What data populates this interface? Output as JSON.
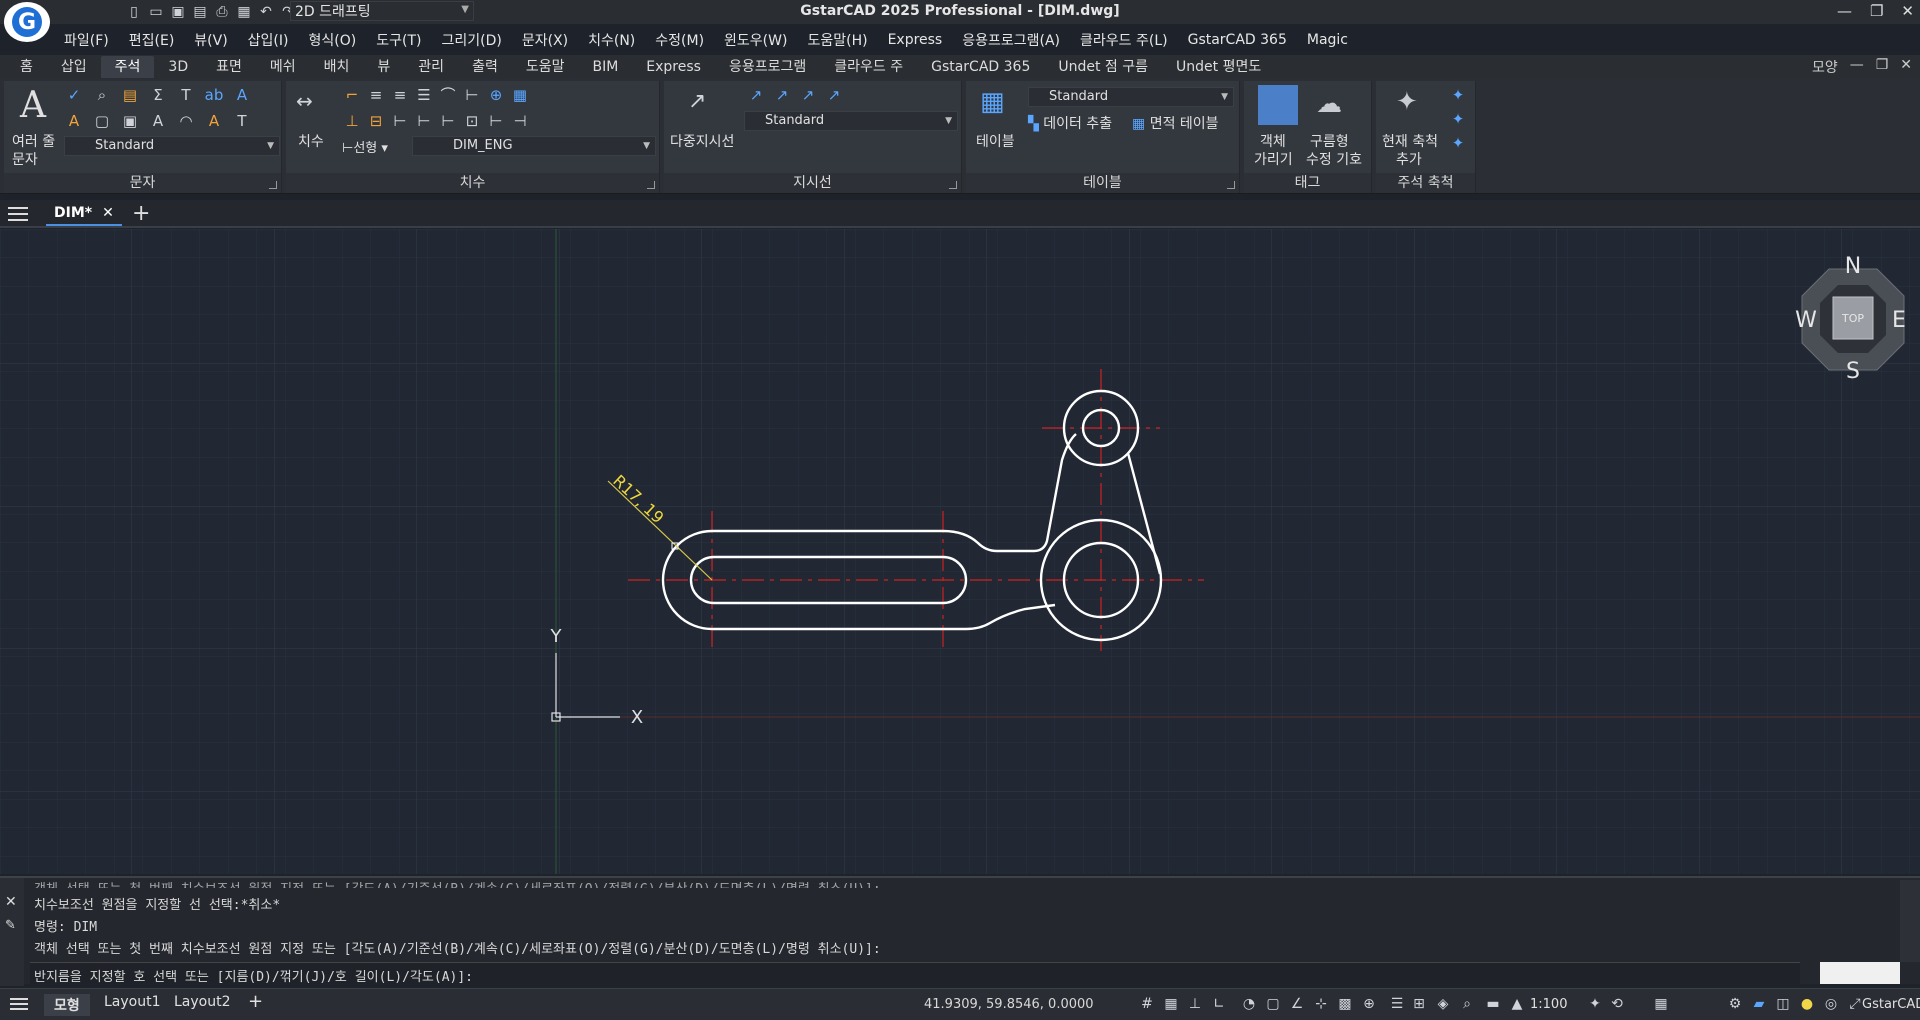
{
  "app": {
    "title": "GstarCAD 2025 Professional - [DIM.dwg]",
    "workspace": "2D 드래프팅",
    "logo_letter": "G"
  },
  "menu": [
    "파일(F)",
    "편집(E)",
    "뷰(V)",
    "삽입(I)",
    "형식(O)",
    "도구(T)",
    "그리기(D)",
    "문자(X)",
    "치수(N)",
    "수정(M)",
    "윈도우(W)",
    "도움말(H)",
    "Express",
    "응용프로그램(A)",
    "클라우드 주(L)",
    "GstarCAD 365",
    "Magic"
  ],
  "ribbon_tabs": [
    "홈",
    "삽입",
    "주석",
    "3D",
    "표면",
    "메쉬",
    "배치",
    "뷰",
    "관리",
    "출력",
    "도움말",
    "BIM",
    "Express",
    "응용프로그램",
    "클라우드 주",
    "GstarCAD 365",
    "Undet 점 구름",
    "Undet 평면도"
  ],
  "ribbon_tab_active": "주석",
  "ribbon_right": "모양",
  "panels": {
    "text": {
      "title": "문자",
      "big_label_1": "여러 줄",
      "big_label_2": "문자",
      "style": "Standard"
    },
    "dim": {
      "title": "치수",
      "big_label": "치수",
      "linear": "선형",
      "style": "DIM_ENG"
    },
    "leader": {
      "title": "지시선",
      "big_label": "다중지시선",
      "style": "Standard"
    },
    "table": {
      "title": "테이블",
      "big_label": "테이블",
      "style": "Standard",
      "extract": "데이터 추출",
      "area": "면적 테이블"
    },
    "tag": {
      "title": "태그",
      "obj_1": "객체",
      "obj_2": "가리기",
      "cloud_1": "구름형",
      "cloud_2": "수정 기호"
    },
    "scale": {
      "title": "주석 축척",
      "label_1": "현재 축척",
      "label_2": "추가"
    }
  },
  "doc_tab": "DIM*",
  "drawing": {
    "dimension_text": "R17, 19",
    "compass": {
      "n": "N",
      "s": "S",
      "e": "E",
      "w": "W",
      "top": "TOP"
    },
    "ucs_x": "X",
    "ucs_y": "Y"
  },
  "command_lines": [
    "객체 선택 또는 첫 번째 치수보조선 원점 지정 또는 [각도(A)/기준선(B)/계속(C)/세로좌표(O)/정렬(G)/분산(D)/도면층(L)/명령 취소(U)]:",
    "치수보조선 원점을 지정할 선 선택:*취소*",
    "명령: DIM",
    "객체 선택 또는 첫 번째 치수보조선 원점 지정 또는 [각도(A)/기준선(B)/계속(C)/세로좌표(O)/정렬(G)/분산(D)/도면층(L)/명령 취소(U)]:"
  ],
  "command_input": "반지름을 지정할 호 선택 또는 [지름(D)/꺾기(J)/호 길이(L)/각도(A)]:",
  "status": {
    "model": "모형",
    "layout1": "Layout1",
    "layout2": "Layout2",
    "coords": "41.9309, 59.8546, 0.0000",
    "scale": "1:100",
    "brand": "GstarCAD"
  }
}
